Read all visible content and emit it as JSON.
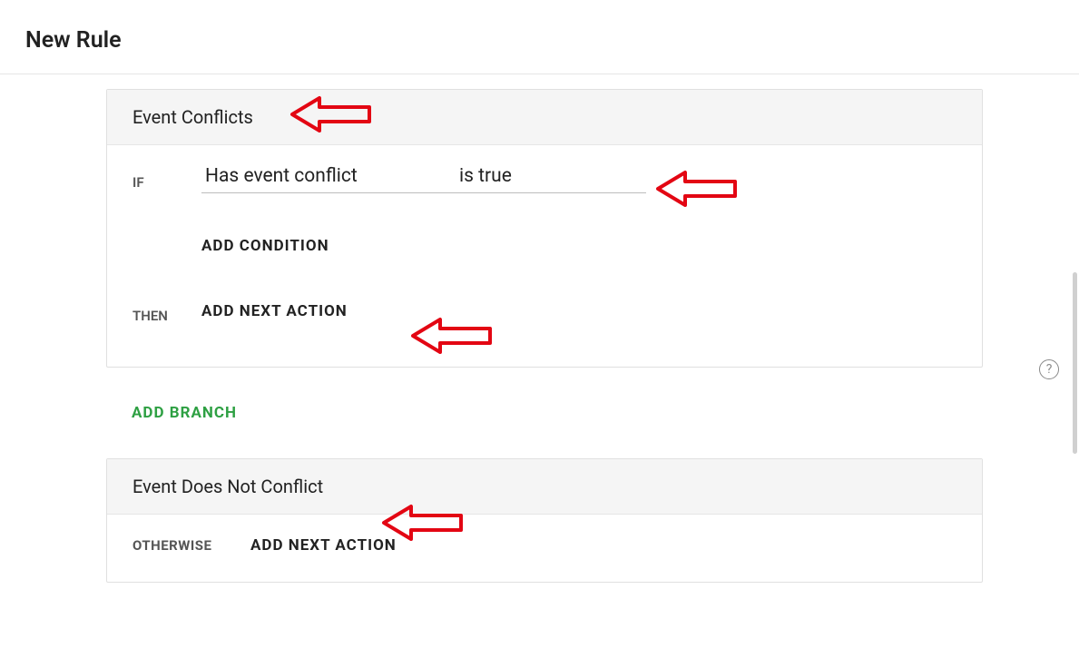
{
  "page": {
    "title": "New Rule"
  },
  "branch1": {
    "title": "Event Conflicts",
    "if_keyword": "IF",
    "then_keyword": "THEN",
    "condition": {
      "field": "Has event conflict",
      "operator": "is true"
    },
    "add_condition_label": "ADD CONDITION",
    "add_next_action_label": "ADD NEXT ACTION"
  },
  "add_branch_label": "ADD BRANCH",
  "branch2": {
    "title": "Event Does Not Conflict",
    "otherwise_keyword": "OTHERWISE",
    "add_next_action_label": "ADD NEXT ACTION"
  },
  "help_icon_glyph": "?",
  "annotations": {
    "arrows_color": "#e30613"
  }
}
